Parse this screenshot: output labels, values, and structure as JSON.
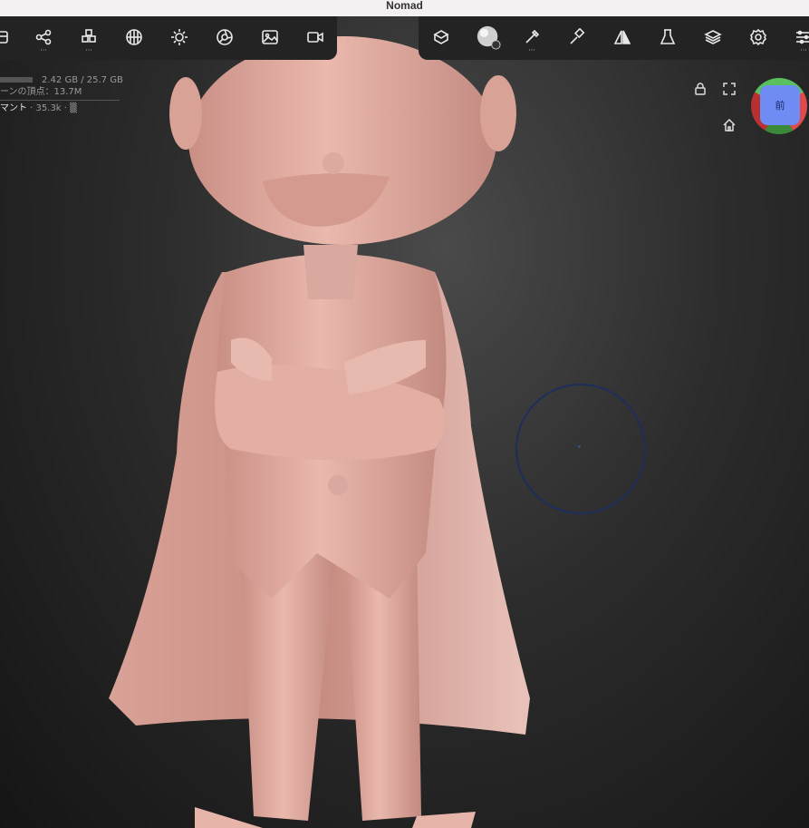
{
  "app": {
    "title": "Nomad"
  },
  "stats": {
    "memory": "2.42 GB / 25.7 GB",
    "scene_vertices": "ーンの頂点：13.7M",
    "mesh_name": "マント",
    "mesh_info": " · 35.3k · ▒"
  },
  "view_cube": {
    "face_label": "前"
  },
  "toolbar_left": [
    "files-icon",
    "scene-graph-icon",
    "primitives-icon",
    "topology-icon",
    "lighting-icon",
    "render-icon",
    "background-icon",
    "camera-icon"
  ],
  "toolbar_right": [
    "transform-icon",
    "material-icon",
    "brush-icon",
    "paint-icon",
    "symmetry-icon",
    "experimental-icon",
    "layers-icon",
    "settings-icon",
    "more-settings-icon"
  ],
  "colors": {
    "skin": "#e9b6aa",
    "background": "#2c2c2c",
    "toolbar": "#232323"
  }
}
